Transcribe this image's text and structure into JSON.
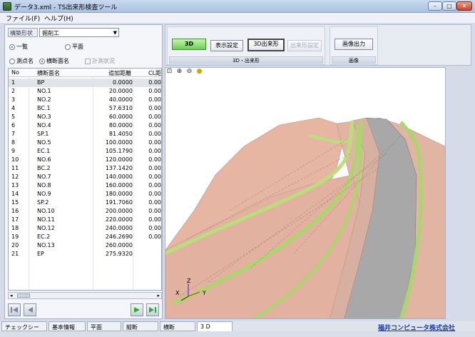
{
  "window": {
    "title": "データ3.xml - TS出来形検査ツール",
    "min_glyph": "–",
    "max_glyph": "□",
    "close_glyph": "✕"
  },
  "menu": {
    "items": [
      "ファイル(F)",
      "ヘルプ(H)"
    ]
  },
  "left": {
    "type_label": "構築形状",
    "type_value": "掘削工",
    "view_options": [
      "一覧",
      "平面"
    ],
    "view_selected": "一覧",
    "point_options": [
      "測点名",
      "横断面名"
    ],
    "point_selected": "横断面名",
    "measure_status_label": "計測状況",
    "table": {
      "headers": [
        "No",
        "横断面名",
        "追加距離",
        "CL距"
      ],
      "rows": [
        [
          "1",
          "BP",
          "0.0000",
          "0.00"
        ],
        [
          "2",
          "NO.1",
          "20.0000",
          "0.00"
        ],
        [
          "3",
          "NO.2",
          "40.0000",
          "0.00"
        ],
        [
          "4",
          "BC.1",
          "57.6310",
          "0.00"
        ],
        [
          "5",
          "NO.3",
          "60.0000",
          "0.00"
        ],
        [
          "6",
          "NO.4",
          "80.0000",
          "0.00"
        ],
        [
          "7",
          "SP.1",
          "81.4050",
          "0.00"
        ],
        [
          "8",
          "NO.5",
          "100.0000",
          "0.00"
        ],
        [
          "9",
          "EC.1",
          "105.1790",
          "0.00"
        ],
        [
          "10",
          "NO.6",
          "120.0000",
          "0.00"
        ],
        [
          "11",
          "BC.2",
          "137.1420",
          "0.00"
        ],
        [
          "12",
          "NO.7",
          "140.0000",
          "0.00"
        ],
        [
          "13",
          "NO.8",
          "160.0000",
          "0.00"
        ],
        [
          "14",
          "NO.9",
          "180.0000",
          "0.00"
        ],
        [
          "15",
          "SP.2",
          "191.7060",
          "0.00"
        ],
        [
          "16",
          "NO.10",
          "200.0000",
          "0.00"
        ],
        [
          "17",
          "NO.11",
          "220.0000",
          "0.00"
        ],
        [
          "18",
          "NO.12",
          "240.0000",
          "0.00"
        ],
        [
          "19",
          "EC.2",
          "246.2690",
          "0.00"
        ],
        [
          "20",
          "NO.13",
          "260.0000",
          ""
        ],
        [
          "21",
          "EP",
          "275.9320",
          ""
        ]
      ],
      "selected_row": 0
    }
  },
  "toolbar": {
    "btn_3d": "3D",
    "btn_display_settings": "表示設定",
    "btn_3d_dekigata": "3D出来形",
    "btn_dekigata_settings": "出来形設定",
    "group1_label": "3D・出来形",
    "btn_image_output": "画像出力",
    "group2_label": "画像"
  },
  "viewport": {
    "tools": [
      "fit-icon",
      "zoom-in-icon",
      "zoom-out-icon",
      "light-icon"
    ],
    "axes": {
      "x": "X",
      "y": "Y",
      "z": "Z"
    }
  },
  "tabs": {
    "items": [
      "チェックシート",
      "基本情報",
      "平面",
      "縦断",
      "横断",
      "3 D"
    ],
    "active": "3 D"
  },
  "company": "福井コンピュータ株式会社",
  "colors": {
    "slope": "#e7b8a6",
    "berm": "#a9d86a",
    "road": "#a9a9a9",
    "sky": "#ffffff"
  }
}
